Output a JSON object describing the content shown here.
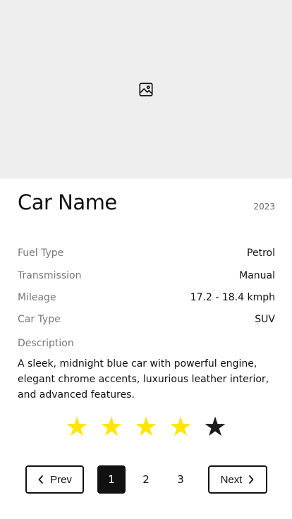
{
  "hero": {
    "icon": "image-placeholder-icon"
  },
  "car": {
    "name": "Car Name",
    "year": "2023"
  },
  "specs": [
    {
      "label": "Fuel Type",
      "value": "Petrol"
    },
    {
      "label": "Transmission",
      "value": "Manual"
    },
    {
      "label": "Mileage",
      "value": "17.2 - 18.4 kmph"
    },
    {
      "label": "Car Type",
      "value": "SUV"
    }
  ],
  "description": {
    "label": "Description",
    "text": "A sleek, midnight blue car with powerful engine, elegant chrome accents, luxurious leather interior, and advanced features."
  },
  "rating": {
    "value": 4,
    "max": 5,
    "filled_color": "#ffe600",
    "empty_color": "#1a1a1a"
  },
  "pagination": {
    "prev_label": "Prev",
    "next_label": "Next",
    "pages": [
      "1",
      "2",
      "3"
    ],
    "current_page": "1"
  }
}
